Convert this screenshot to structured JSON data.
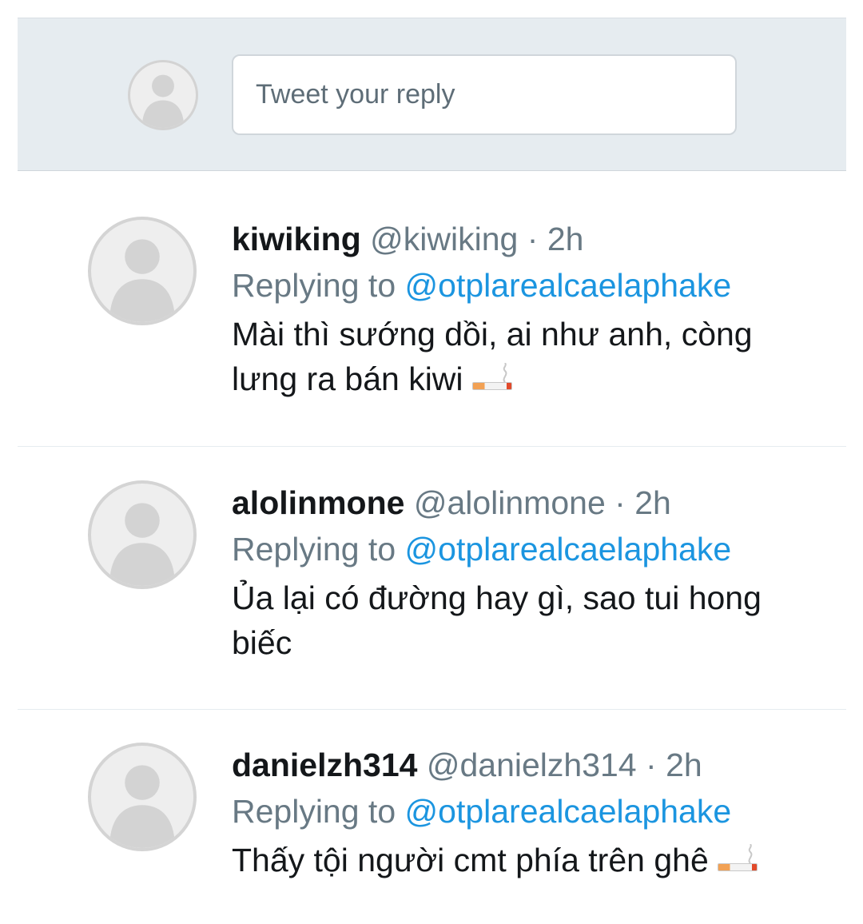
{
  "reply_box": {
    "placeholder": "Tweet your reply"
  },
  "tweets": [
    {
      "display_name": "kiwiking",
      "handle": "@kiwiking",
      "separator": "·",
      "time": "2h",
      "replying_prefix": "Replying to",
      "replying_mention": "@otplarealcaelaphake",
      "text_line1": "Mài thì sướng dồi, ai như anh, còng",
      "text_line2": "lưng ra bán kiwi",
      "emoji": "cigarette-icon"
    },
    {
      "display_name": "alolinmone",
      "handle": "@alolinmone",
      "separator": "·",
      "time": "2h",
      "replying_prefix": "Replying to",
      "replying_mention": "@otplarealcaelaphake",
      "text_line1": "Ủa lại có đường hay gì, sao tui hong",
      "text_line2": "biếc"
    },
    {
      "display_name": "danielzh314",
      "handle": "@danielzh314",
      "separator": "·",
      "time": "2h",
      "replying_prefix": "Replying to",
      "replying_mention": "@otplarealcaelaphake",
      "text_line1": "Thấy tội người cmt phía trên ghê",
      "emoji": "cigarette-icon"
    }
  ],
  "colors": {
    "accent": "#1b95e0",
    "secondary_text": "#687984",
    "primary_text": "#14171a",
    "reply_bar_bg": "#e6ecf0"
  }
}
